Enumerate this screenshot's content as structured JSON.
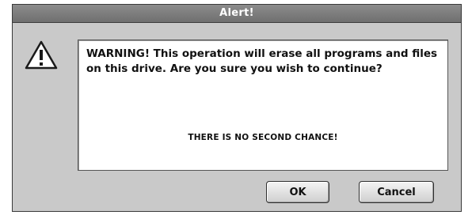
{
  "dialog": {
    "title": "Alert!",
    "icon": "warning-triangle-icon",
    "message": "WARNING!  This operation will erase all programs and files on this drive. Are you sure you wish to continue?",
    "emphasis": "THERE IS NO SECOND CHANCE!",
    "buttons": {
      "ok_label": "OK",
      "cancel_label": "Cancel"
    }
  }
}
